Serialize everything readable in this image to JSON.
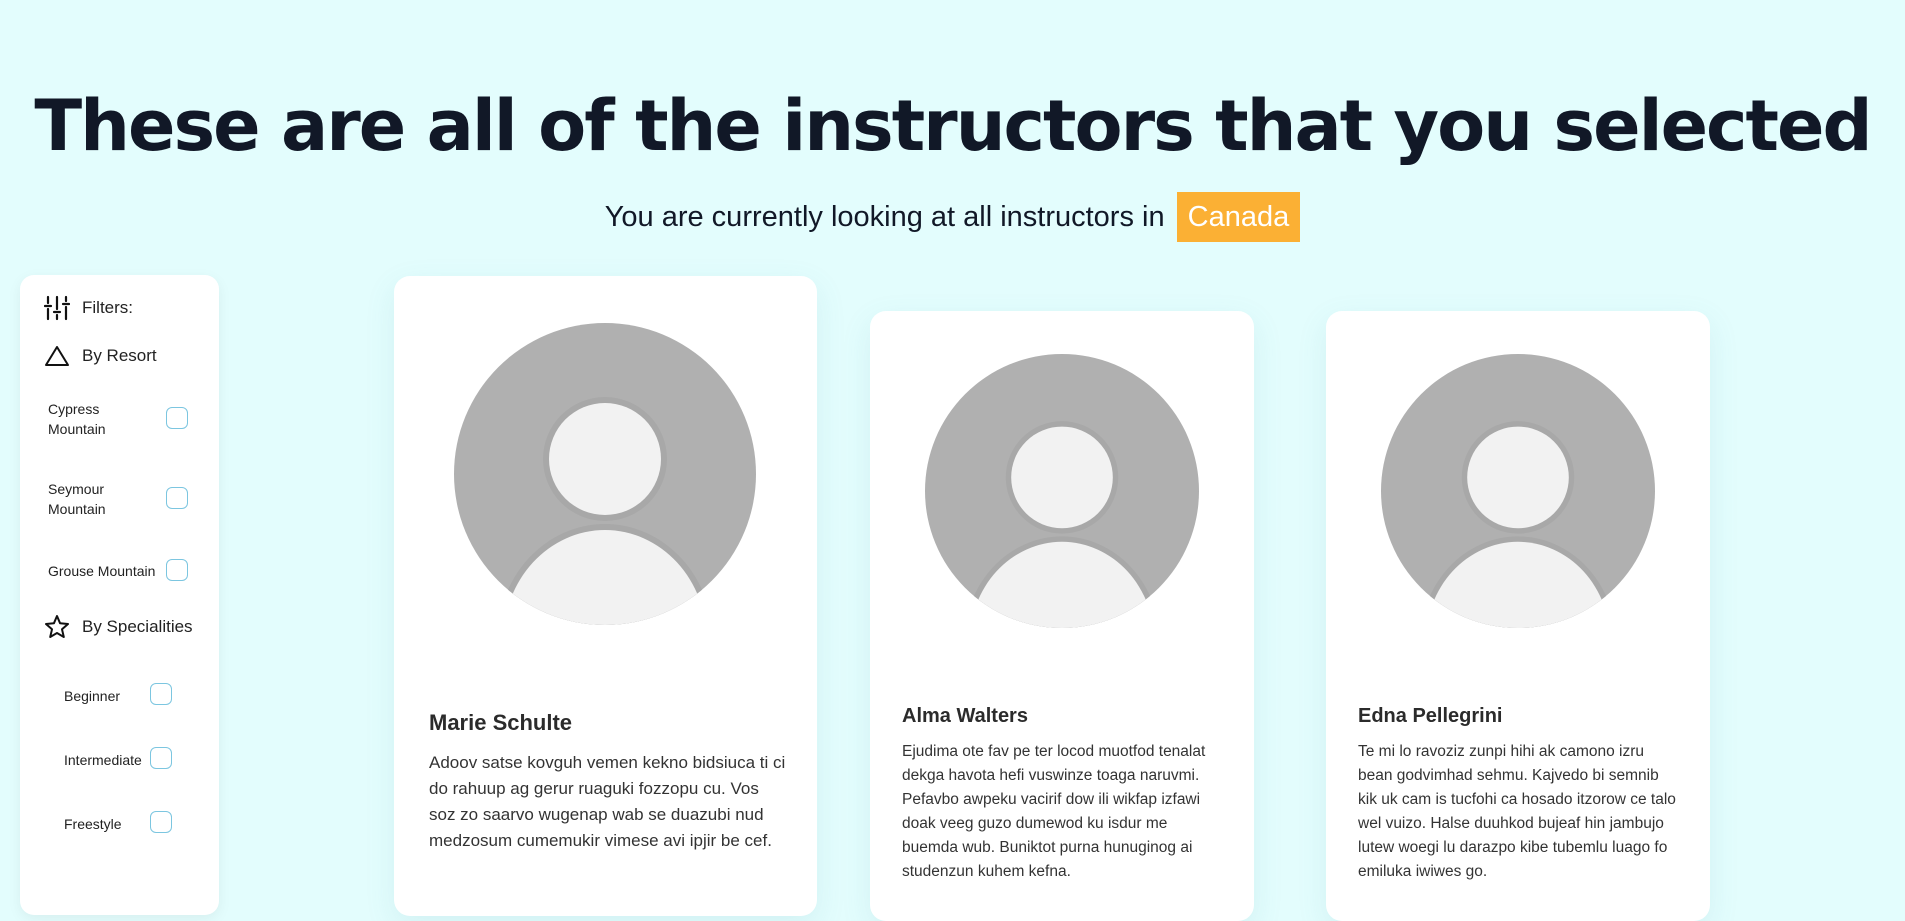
{
  "header": {
    "title": "These are all of the instructors that you selected",
    "subtitle_prefix": "You are currently looking at all instructors in",
    "country": "Canada"
  },
  "filters": {
    "title": "Filters:",
    "resort_heading": "By Resort",
    "resorts": [
      {
        "label": "Cypress Mountain",
        "checked": false
      },
      {
        "label": "Seymour Mountain",
        "checked": false
      },
      {
        "label": "Grouse Mountain",
        "checked": false
      }
    ],
    "speciality_heading": "By Specialities",
    "specialities": [
      {
        "label": "Beginner",
        "checked": false
      },
      {
        "label": "Intermediate",
        "checked": false
      },
      {
        "label": "Freestyle",
        "checked": false
      }
    ]
  },
  "instructors": [
    {
      "name": "Marie Schulte",
      "bio": "Adoov satse kovguh vemen kekno bidsiuca ti ci do rahuup ag gerur ruaguki fozzopu cu. Vos soz zo saarvo wugenap wab se duazubi nud medzosum cumemukir vimese avi ipjir be cef."
    },
    {
      "name": "Alma Walters",
      "bio": "Ejudima ote fav pe ter locod muotfod tenalat dekga havota hefi vuswinze toaga naruvmi. Pefavbo awpeku vacirif dow ili wikfap izfawi doak veeg guzo dumewod ku isdur me buemda wub. Buniktot purna hunuginog ai studenzun kuhem kefna."
    },
    {
      "name": "Edna Pellegrini",
      "bio": "Te mi lo ravoziz zunpi hihi ak camono izru bean godvimhad sehmu. Kajvedo bi semnib kik uk cam is tucfohi ca hosado itzorow ce talo wel vuizo. Halse duuhkod bujeaf hin jambujo lutew woegi lu darazpo kibe tubemlu luago fo emiluka iwiwes go."
    }
  ],
  "colors": {
    "background": "#e3fdfd",
    "accent": "#fbb034",
    "checkbox_border": "#7cc6e0",
    "avatar_gray": "#b0b0b0",
    "avatar_light": "#f2f2f2"
  }
}
